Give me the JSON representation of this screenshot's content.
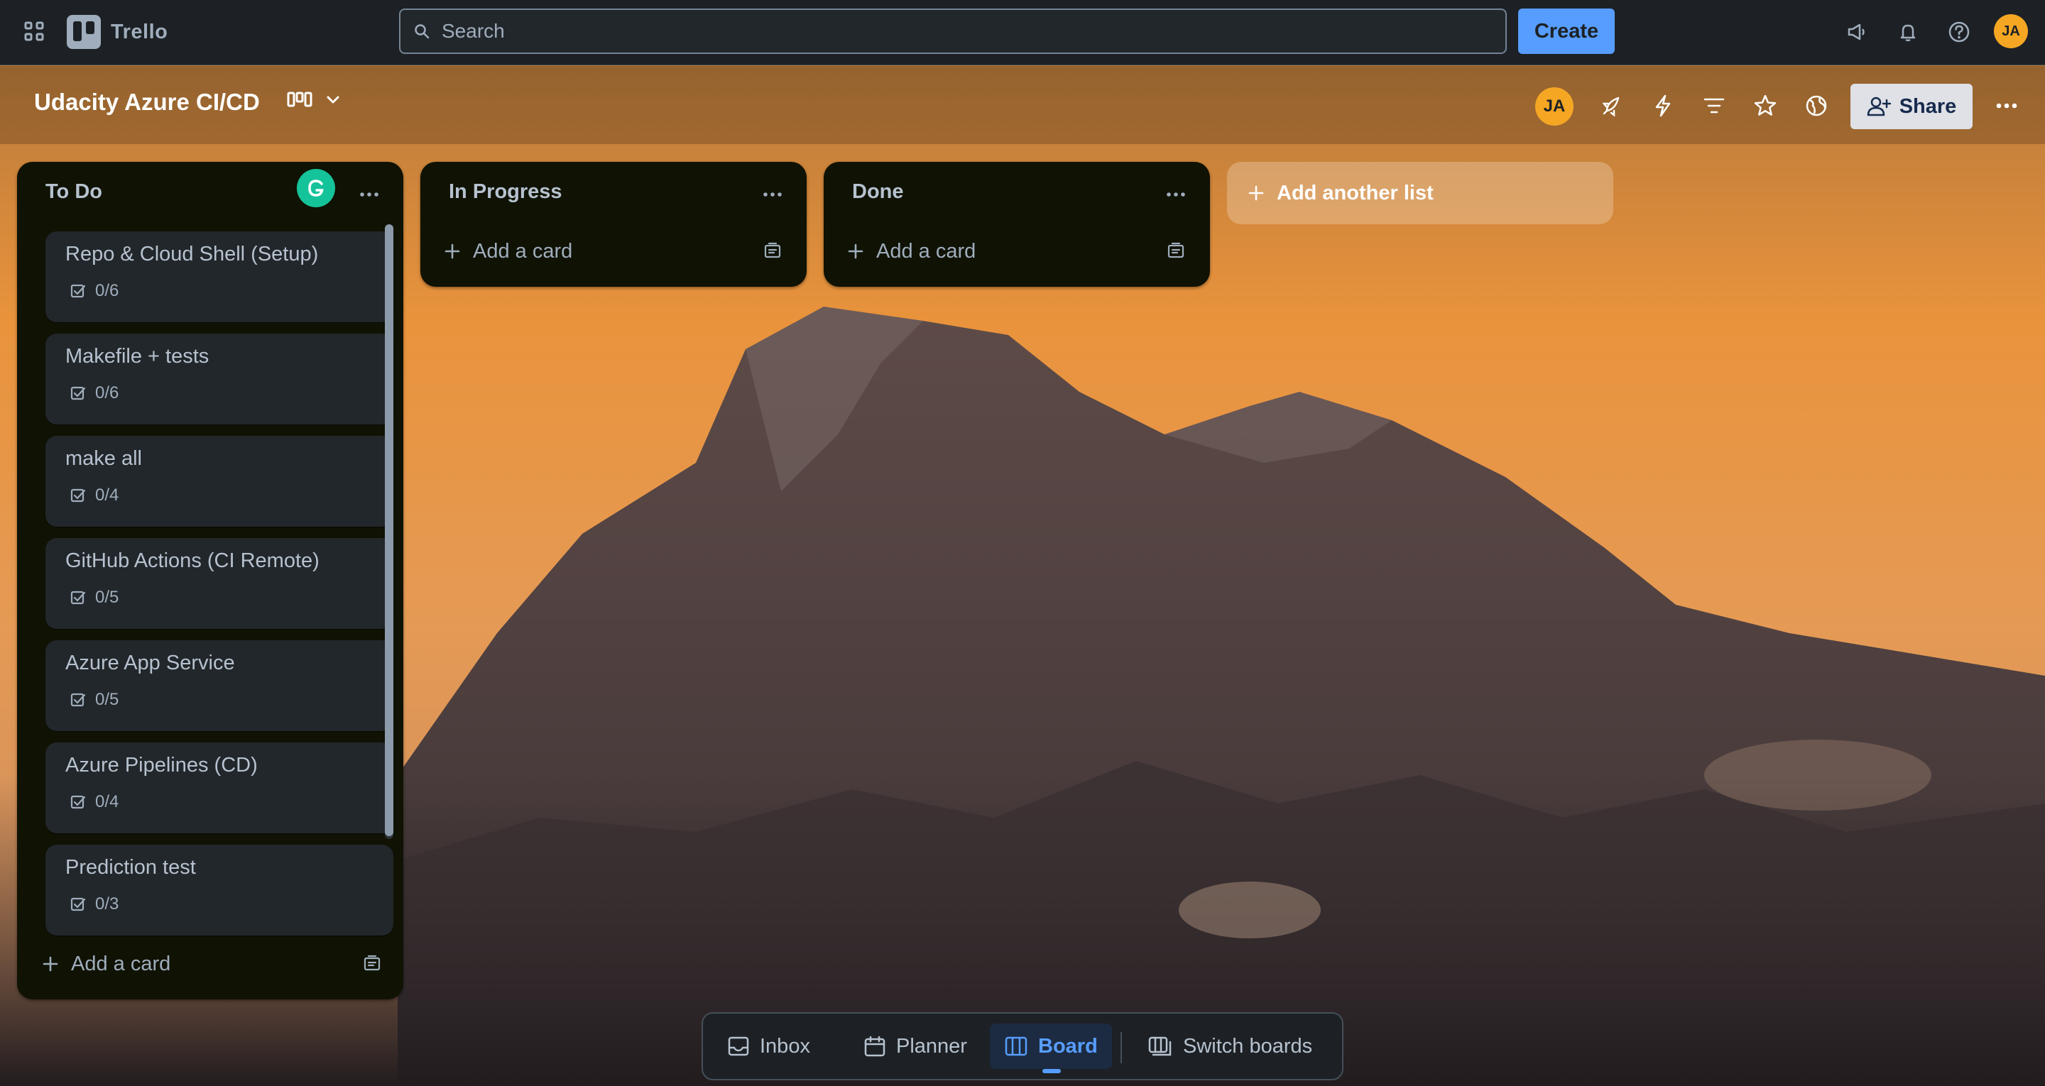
{
  "app": {
    "name": "Trello"
  },
  "search": {
    "placeholder": "Search"
  },
  "topbar": {
    "create_label": "Create",
    "user_initials": "JA"
  },
  "board": {
    "title": "Udacity Azure CI/CD",
    "member_initials": "JA",
    "share_label": "Share"
  },
  "lists": [
    {
      "title": "To Do",
      "cards": [
        {
          "title": "Repo & Cloud Shell (Setup)",
          "checklist": "0/6"
        },
        {
          "title": "Makefile + tests",
          "checklist": "0/6"
        },
        {
          "title": "make all",
          "checklist": "0/4"
        },
        {
          "title": "GitHub Actions (CI Remote)",
          "checklist": "0/5"
        },
        {
          "title": "Azure App Service",
          "checklist": "0/5"
        },
        {
          "title": "Azure Pipelines (CD)",
          "checklist": "0/4"
        },
        {
          "title": "Prediction test",
          "checklist": "0/3"
        }
      ],
      "add_card_label": "Add a card"
    },
    {
      "title": "In Progress",
      "cards": [],
      "add_card_label": "Add a card"
    },
    {
      "title": "Done",
      "cards": [],
      "add_card_label": "Add a card"
    }
  ],
  "add_list_label": "Add another list",
  "bottom_nav": {
    "items": [
      {
        "label": "Inbox",
        "icon": "inbox-icon"
      },
      {
        "label": "Planner",
        "icon": "calendar-icon"
      },
      {
        "label": "Board",
        "icon": "board-icon",
        "active": true
      },
      {
        "label": "Switch boards",
        "icon": "switch-boards-icon"
      }
    ]
  },
  "colors": {
    "accent": "#579dff",
    "avatar": "#f5a623",
    "list_bg": "#101204",
    "card_bg": "#22272b"
  }
}
